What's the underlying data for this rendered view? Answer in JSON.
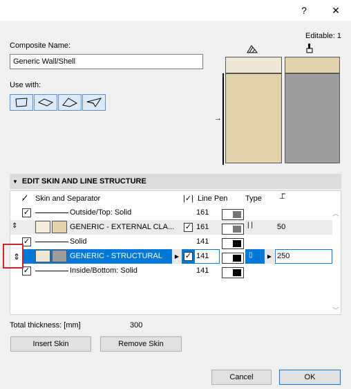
{
  "titlebar": {
    "help": "?",
    "close": "✕"
  },
  "editable": "Editable: 1",
  "composite_name_label": "Composite Name:",
  "composite_name_value": "Generic Wall/Shell",
  "use_with_label": "Use with:",
  "section_title": "EDIT SKIN AND LINE STRUCTURE",
  "columns": {
    "skin": "Skin and Separator",
    "linepen": "Line Pen",
    "type": "Type"
  },
  "rows": [
    {
      "name": "Outside/Top: Solid",
      "pen": "161"
    },
    {
      "name": "GENERIC - EXTERNAL CLA...",
      "pen": "161",
      "thickness": "50"
    },
    {
      "name": "Solid",
      "pen": "141"
    },
    {
      "name": "GENERIC - STRUCTURAL",
      "pen": "141",
      "thickness": "250"
    },
    {
      "name": "Inside/Bottom: Solid",
      "pen": "141"
    }
  ],
  "total_label": "Total thickness: [mm]",
  "total_value": "300",
  "buttons": {
    "insert": "Insert Skin",
    "remove": "Remove Skin",
    "cancel": "Cancel",
    "ok": "OK"
  },
  "colors": {
    "selection": "#0078d7",
    "external_fill": "#e0d2ad",
    "structural_fill": "#9c9c9c",
    "highlight_box": "#c0282c"
  }
}
